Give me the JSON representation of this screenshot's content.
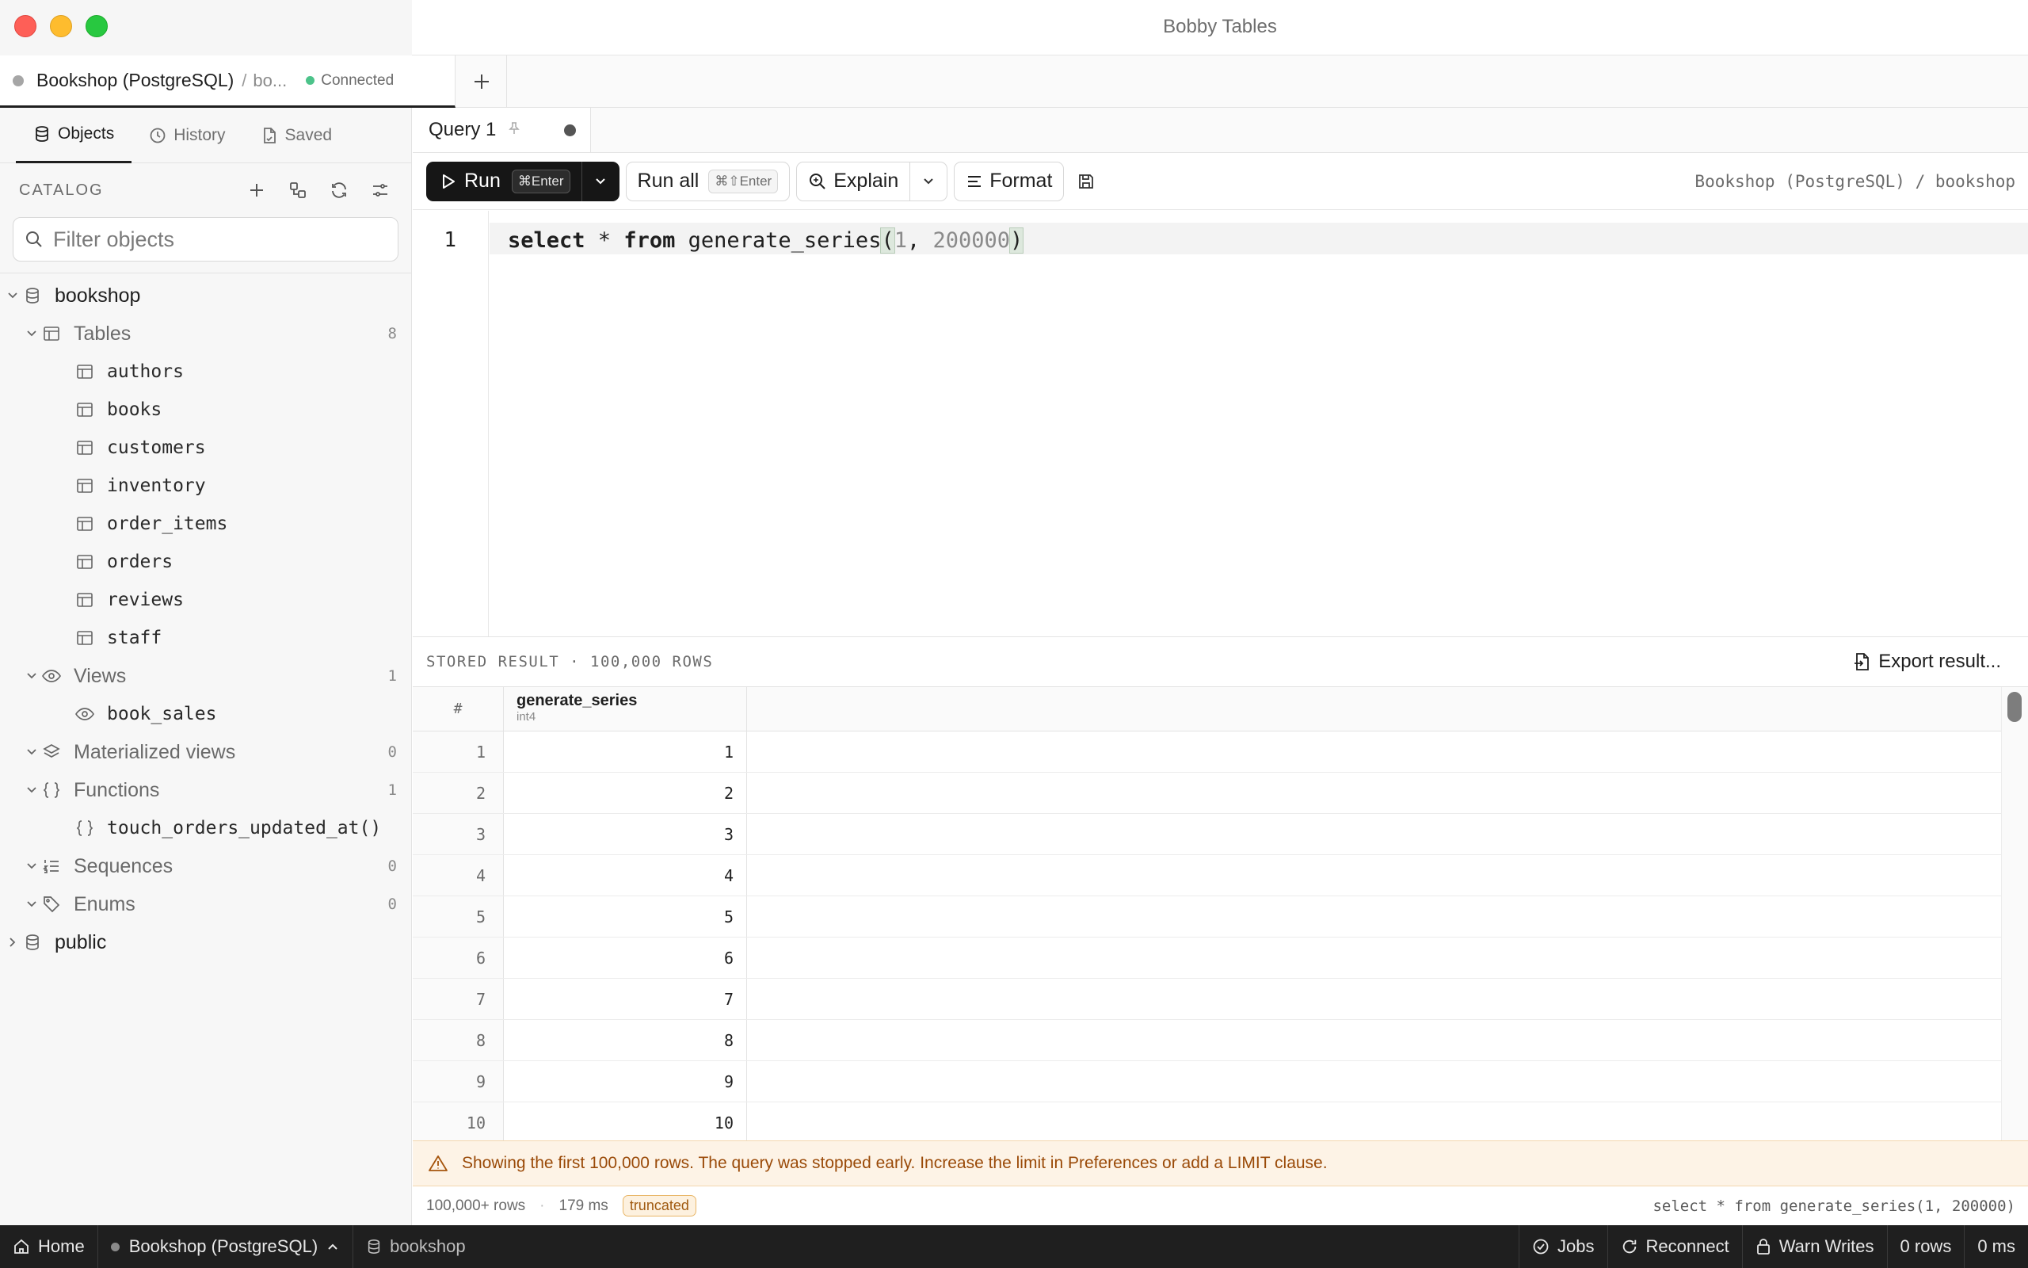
{
  "window": {
    "title": "Bobby Tables"
  },
  "connection_tab": {
    "name": "Bookshop (PostgreSQL)",
    "separator": "/",
    "database_short": "bo...",
    "status": "Connected"
  },
  "sidebar": {
    "tabs": [
      {
        "label": "Objects",
        "icon": "database-icon",
        "active": true
      },
      {
        "label": "History",
        "icon": "clock-icon",
        "active": false
      },
      {
        "label": "Saved",
        "icon": "saved-file-icon",
        "active": false
      }
    ],
    "catalog_label": "CATALOG",
    "filter_placeholder": "Filter objects",
    "tree": {
      "schema_bookshop": "bookshop",
      "tables_label": "Tables",
      "tables_count": "8",
      "tables": [
        "authors",
        "books",
        "customers",
        "inventory",
        "order_items",
        "orders",
        "reviews",
        "staff"
      ],
      "views_label": "Views",
      "views_count": "1",
      "views": [
        "book_sales"
      ],
      "matviews_label": "Materialized views",
      "matviews_count": "0",
      "functions_label": "Functions",
      "functions_count": "1",
      "functions": [
        "touch_orders_updated_at()"
      ],
      "sequences_label": "Sequences",
      "sequences_count": "0",
      "enums_label": "Enums",
      "enums_count": "0",
      "schema_public": "public"
    }
  },
  "query_tab": {
    "label": "Query 1"
  },
  "toolbar": {
    "run_label": "Run",
    "run_shortcut": "⌘Enter",
    "run_all_label": "Run all",
    "run_all_shortcut": "⌘⇧Enter",
    "explain_label": "Explain",
    "format_label": "Format",
    "context": "Bookshop (PostgreSQL) / bookshop"
  },
  "editor": {
    "line_number": "1",
    "code": {
      "kw_select": "select",
      "star": " * ",
      "kw_from": "from",
      "fn": " generate_series",
      "open_paren": "(",
      "arg1": "1",
      "comma": ", ",
      "arg2": "200000",
      "close_paren": ")"
    }
  },
  "result": {
    "title": "STORED RESULT · 100,000 ROWS",
    "export_label": "Export result...",
    "index_header": "#",
    "column": {
      "name": "generate_series",
      "type": "int4"
    },
    "rows": [
      {
        "idx": "1",
        "value": "1"
      },
      {
        "idx": "2",
        "value": "2"
      },
      {
        "idx": "3",
        "value": "3"
      },
      {
        "idx": "4",
        "value": "4"
      },
      {
        "idx": "5",
        "value": "5"
      },
      {
        "idx": "6",
        "value": "6"
      },
      {
        "idx": "7",
        "value": "7"
      },
      {
        "idx": "8",
        "value": "8"
      },
      {
        "idx": "9",
        "value": "9"
      },
      {
        "idx": "10",
        "value": "10"
      }
    ],
    "warning": "Showing the first 100,000 rows. The query was stopped early. Increase the limit in Preferences or add a LIMIT clause.",
    "rows_status": "100,000+ rows",
    "time_status": "179 ms",
    "truncated_badge": "truncated",
    "query_text": "select * from generate_series(1, 200000)"
  },
  "statusbar": {
    "home": "Home",
    "connection": "Bookshop (PostgreSQL)",
    "database": "bookshop",
    "jobs": "Jobs",
    "reconnect": "Reconnect",
    "warn_writes": "Warn Writes",
    "rows": "0 rows",
    "time": "0 ms"
  }
}
